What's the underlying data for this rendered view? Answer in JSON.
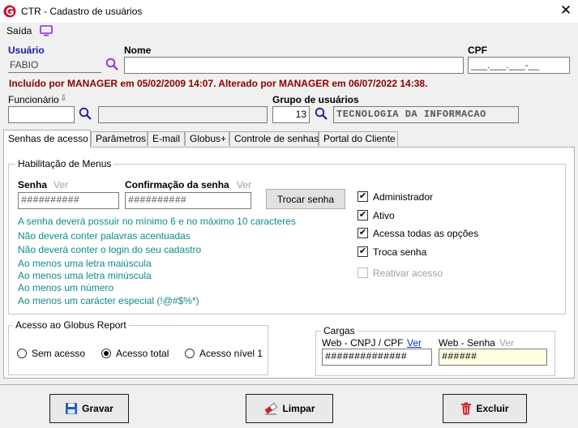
{
  "window": {
    "title": "CTR - Cadastro de usuários",
    "close_glyph": "✕"
  },
  "menu": {
    "exit_label": "Saída"
  },
  "fields": {
    "usuario_label": "Usuário",
    "usuario_value": "FABIO",
    "nome_label": "Nome",
    "nome_value": "",
    "cpf_label": "CPF",
    "cpf_value": "___.___.___-__",
    "info_line": "Incluído por MANAGER em 05/02/2009 14:07. Alterado por MANAGER em 06/07/2022 14:38.",
    "funcionario_label": "Funcionário",
    "funcionario_sort_glyph": "⇩",
    "funcionario_code": "",
    "funcionario_name": "",
    "grupo_label": "Grupo de usuários",
    "grupo_code": "13",
    "grupo_name": "TECNOLOGIA DA INFORMACAO"
  },
  "tabs": [
    {
      "label": "Senhas de acesso",
      "active": true
    },
    {
      "label": "Parâmetros",
      "active": false
    },
    {
      "label": "E-mail",
      "active": false
    },
    {
      "label": "Globus+",
      "active": false
    },
    {
      "label": "Controle de senhas",
      "active": false
    },
    {
      "label": "Portal do Cliente",
      "active": false
    }
  ],
  "habilitacao": {
    "title": "Habilitação de Menus",
    "senha_label": "Senha",
    "ver_label": "Ver",
    "senha_value": "##########",
    "confirm_label": "Confirmação da senha",
    "confirm_ver_label": "Ver",
    "confirm_value": "##########",
    "trocar_button": "Trocar senha",
    "rules": [
      "A senha deverá possuir no mínimo 6 e no máximo 10 caracteres",
      "Não deverá conter palavras acentuadas",
      "Não deverá conter o login do seu cadastro",
      "Ao menos uma letra maiúscula",
      "Ao menos uma letra minúscula",
      "Ao menos um número",
      "Ao menos um carácter especial (!@#$%*)"
    ],
    "checkboxes": [
      {
        "label": "Administrador",
        "checked": true,
        "enabled": true
      },
      {
        "label": "Ativo",
        "checked": true,
        "enabled": true
      },
      {
        "label": "Acessa todas as opções",
        "checked": true,
        "enabled": true
      },
      {
        "label": "Troca senha",
        "checked": true,
        "enabled": true
      },
      {
        "label": "Reativar acesso",
        "checked": false,
        "enabled": false
      }
    ],
    "check_glyph": "✔"
  },
  "globus_report": {
    "title": "Acesso ao Globus Report",
    "options": [
      {
        "label": "Sem acesso",
        "selected": false
      },
      {
        "label": "Acesso total",
        "selected": true
      },
      {
        "label": "Acesso nível 1",
        "selected": false
      }
    ]
  },
  "cargas": {
    "title": "Cargas",
    "cnpj_label": "Web - CNPJ / CPF",
    "cnpj_ver": "Ver",
    "cnpj_value": "##############",
    "senha_label": "Web - Senha",
    "senha_ver": "Ver",
    "senha_value": "######"
  },
  "actions": {
    "gravar": "Gravar",
    "limpar": "Limpar",
    "excluir": "Excluir"
  },
  "colors": {
    "accent_purple": "#8a2be2",
    "info_red": "#8b0000",
    "rule_teal": "#0e8b8b",
    "web_senha_bg": "#ffffe1"
  }
}
